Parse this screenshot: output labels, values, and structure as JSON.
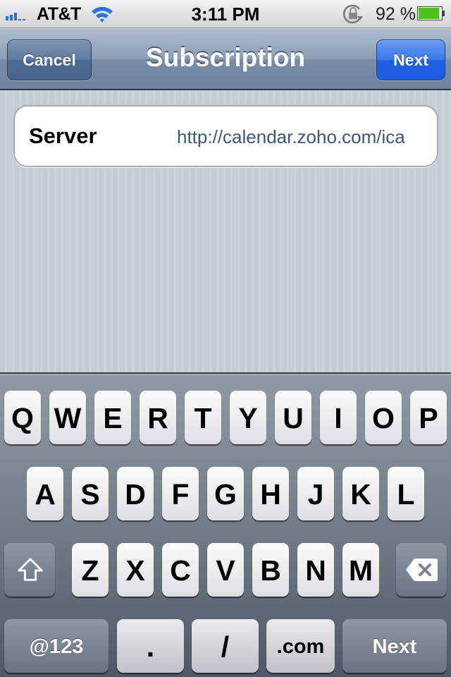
{
  "status_bar": {
    "carrier": "AT&T",
    "time": "3:11 PM",
    "battery_percent": "92 %",
    "battery_level": 0.92,
    "icons": {
      "signal": "signal-bars-icon",
      "wifi": "wifi-icon",
      "rotation_lock": "rotation-lock-icon",
      "battery": "battery-icon"
    }
  },
  "nav_bar": {
    "title": "Subscription",
    "cancel_label": "Cancel",
    "next_label": "Next"
  },
  "form": {
    "fields": [
      {
        "label": "Server",
        "value": "http://calendar.zoho.com/ica"
      }
    ]
  },
  "keyboard": {
    "row1": [
      "Q",
      "W",
      "E",
      "R",
      "T",
      "Y",
      "U",
      "I",
      "O",
      "P"
    ],
    "row2": [
      "A",
      "S",
      "D",
      "F",
      "G",
      "H",
      "J",
      "K",
      "L"
    ],
    "row3": [
      "Z",
      "X",
      "C",
      "V",
      "B",
      "N",
      "M"
    ],
    "shift_icon": "shift-arrow-icon",
    "delete_icon": "backspace-icon",
    "bottom": {
      "numbers_label": "@123",
      "dot_label": ".",
      "slash_label": "/",
      "dotcom_label": ".com",
      "return_label": "Next"
    }
  },
  "colors": {
    "accent_blue": "#1f5fe0",
    "nav_bar": "#7a8ca6",
    "field_value_text": "#3a5688",
    "battery_green": "#4fc11f"
  }
}
